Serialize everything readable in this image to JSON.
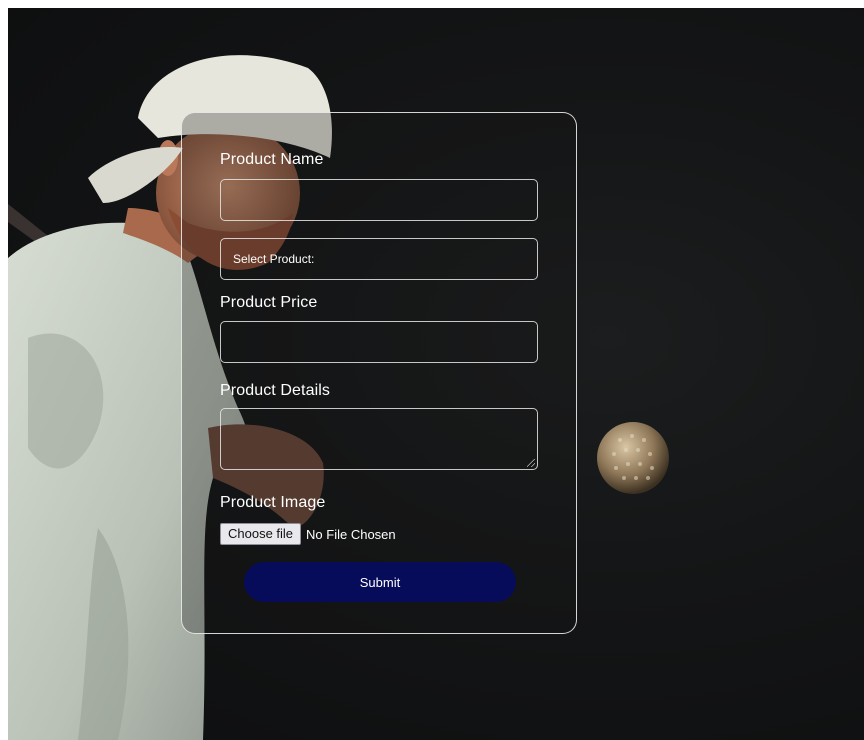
{
  "form": {
    "product_name_label": "Product Name",
    "product_name_value": "",
    "select_product_placeholder": "Select Product:",
    "product_price_label": "Product Price",
    "product_price_value": "",
    "product_details_label": "Product Details",
    "product_details_value": "",
    "product_image_label": "Product Image",
    "choose_file_label": "Choose file",
    "file_status": "No File Chosen",
    "submit_label": "Submit"
  },
  "colors": {
    "background": "#131415",
    "submit_button": "#070c5a",
    "card_border": "#ebebeb"
  }
}
